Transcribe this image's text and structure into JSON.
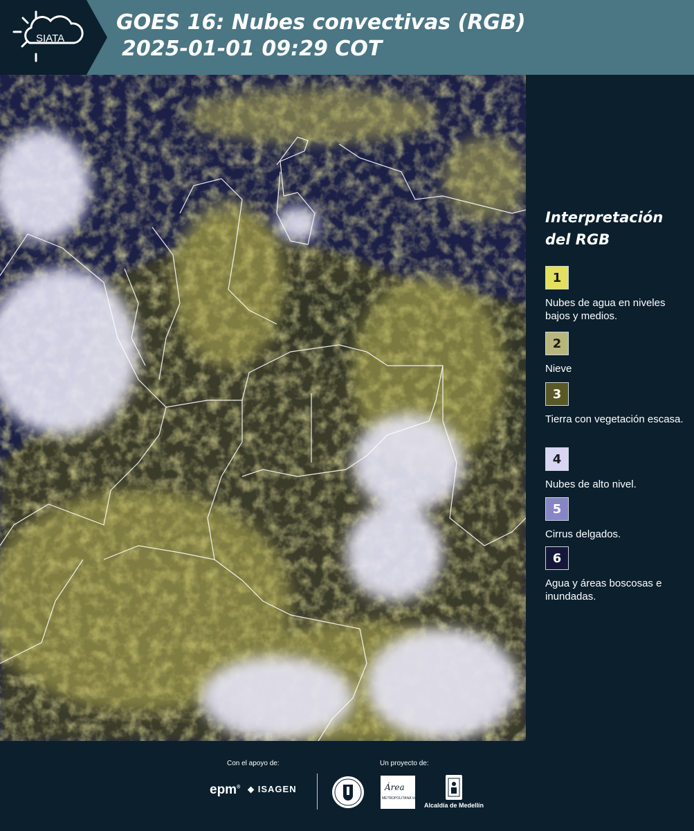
{
  "header": {
    "logo_text": "SIATA",
    "logo_icon": "sun-cloud-icon",
    "title_line1": "GOES 16: Nubes convectivas (RGB)",
    "title_line2": "2025-01-01 09:29 COT"
  },
  "legend": {
    "title_line1": "Interpretación",
    "title_line2": "del RGB",
    "items": [
      {
        "number": "1",
        "color": "#e3df60",
        "label": "Nubes de agua en niveles bajos y medios.",
        "text_color": "#1a1a1a"
      },
      {
        "number": "2",
        "color": "#b8b77a",
        "label": "Nieve",
        "text_color": "#1a1a1a"
      },
      {
        "number": "3",
        "color": "#5a5824",
        "label": "Tierra con vegetación escasa.",
        "text_color": "#ffffff"
      },
      {
        "number": "4",
        "color": "#d8d6f2",
        "label": "Nubes de alto nivel.",
        "text_color": "#1a1a1a"
      },
      {
        "number": "5",
        "color": "#8785c6",
        "label": "Cirrus delgados.",
        "text_color": "#ffffff"
      },
      {
        "number": "6",
        "color": "#15173a",
        "label": "Agua y áreas boscosas e inundadas.",
        "text_color": "#ffffff"
      }
    ]
  },
  "footer": {
    "support_label": "Con el apoyo de:",
    "project_label": "Un proyecto de:",
    "epm": "epm",
    "isagen": "ISAGEN",
    "area_name": "Área",
    "area_sub": "METROPOLITANA Valle de Aburrá",
    "alcaldia": "Alcaldía de Medellín"
  },
  "colors": {
    "header_bg": "#4b7684",
    "panel_bg": "#0b1f2d",
    "water": "#1c1f45",
    "cloud_low": "#d9d45a",
    "cloud_high": "#e6e6f5"
  }
}
